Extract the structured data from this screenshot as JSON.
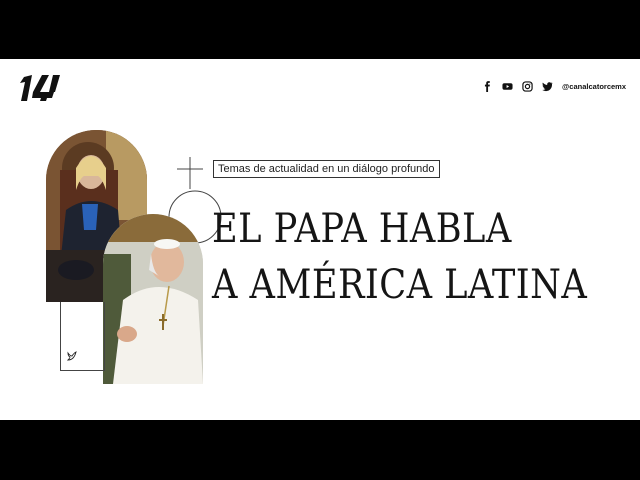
{
  "logo": {
    "text": "14"
  },
  "social": {
    "icons": [
      "facebook-icon",
      "youtube-icon",
      "instagram-icon",
      "twitter-icon"
    ],
    "handle": "@canalcatorcemx"
  },
  "tagline": "Temas de actualidad en un diálogo profundo",
  "headline": {
    "line1": "EL PAPA HABLA",
    "line2": "A AMÉRICA LATINA"
  },
  "colors": {
    "background": "#ffffff",
    "letterbox": "#000000",
    "text": "#151515"
  }
}
